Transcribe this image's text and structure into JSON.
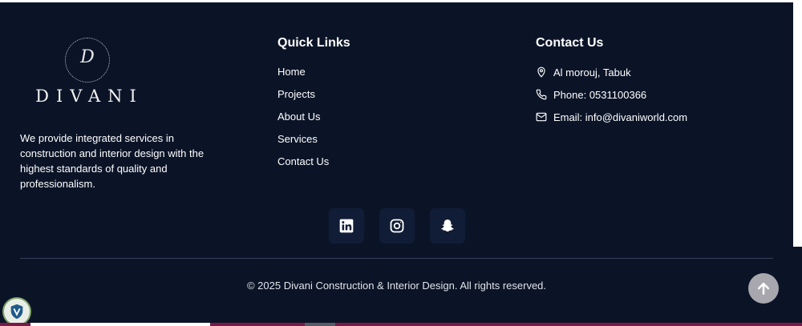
{
  "brand": {
    "monogram": "D",
    "name": "DIVANI",
    "description": "We provide integrated services in construction and interior design with the highest standards of quality and professionalism."
  },
  "quick_links": {
    "title": "Quick Links",
    "items": [
      "Home",
      "Projects",
      "About Us",
      "Services",
      "Contact Us"
    ]
  },
  "contact": {
    "title": "Contact Us",
    "location": "Al morouj, Tabuk",
    "phone": "Phone: 0531100366",
    "email": "Email: info@divaniworld.com"
  },
  "social": [
    "linkedin-icon",
    "instagram-icon",
    "snapchat-icon"
  ],
  "copyright": "© 2025 Divani Construction & Interior Design. All rights reserved.",
  "colors": {
    "background": "#0b1427",
    "social_tile": "#111d36",
    "scroll_button": "#a7a7ad"
  }
}
